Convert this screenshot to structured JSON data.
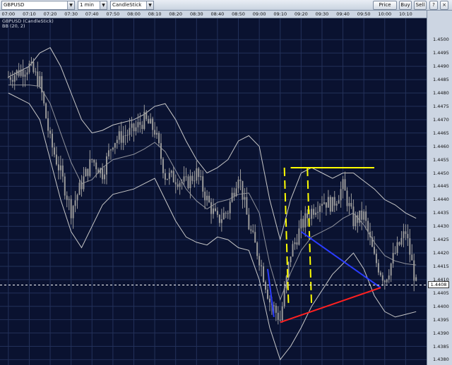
{
  "toolbar": {
    "symbol": "GBPUSD",
    "interval": "1 min",
    "chart_style": "CandleStick",
    "price_box_label": "Price Box",
    "buy_label": "Buy",
    "sell_label": "Sell",
    "icons": [
      "help-icon",
      "close-icon"
    ]
  },
  "chart_header": {
    "title": "GBPUSD (CandleStick)",
    "study": "BB (20, 2)"
  },
  "colors": {
    "background": "#0a1230",
    "grid": "#23315a",
    "candles": "#9a9a9a",
    "bands": "#c8c8c8",
    "yellow": "#ffff00",
    "blue": "#2a3cff",
    "red": "#ff2020"
  },
  "chart_data": {
    "type": "candlestick",
    "title": "GBPUSD (CandleStick)",
    "xlabel": "",
    "ylabel": "",
    "time_ticks": [
      "07:00",
      "07:10",
      "07:20",
      "07:30",
      "07:40",
      "07:50",
      "08:00",
      "08:10",
      "08:20",
      "08:30",
      "08:40",
      "08:50",
      "09:00",
      "09:10",
      "09:20",
      "09:30",
      "09:40",
      "09:50",
      "10:00",
      "10:10"
    ],
    "price_ticks": [
      "1.4500",
      "1.4495",
      "1.4490",
      "1.4485",
      "1.4480",
      "1.4475",
      "1.4470",
      "1.4465",
      "1.4460",
      "1.4455",
      "1.4450",
      "1.4445",
      "1.4440",
      "1.4435",
      "1.4430",
      "1.4425",
      "1.4420",
      "1.4415",
      "1.4410",
      "1.4405",
      "1.4400",
      "1.4395",
      "1.4390",
      "1.4385",
      "1.4380"
    ],
    "ylim": [
      1.4378,
      1.4508
    ],
    "last_price": "1.4408",
    "close_series": [
      {
        "t": "07:00",
        "v": 1.4486
      },
      {
        "t": "07:10",
        "v": 1.449
      },
      {
        "t": "07:15",
        "v": 1.4484
      },
      {
        "t": "07:20",
        "v": 1.4462
      },
      {
        "t": "07:25",
        "v": 1.445
      },
      {
        "t": "07:30",
        "v": 1.4436
      },
      {
        "t": "07:35",
        "v": 1.4446
      },
      {
        "t": "07:40",
        "v": 1.4455
      },
      {
        "t": "07:45",
        "v": 1.445
      },
      {
        "t": "07:50",
        "v": 1.4462
      },
      {
        "t": "08:00",
        "v": 1.4466
      },
      {
        "t": "08:05",
        "v": 1.447
      },
      {
        "t": "08:10",
        "v": 1.4466
      },
      {
        "t": "08:15",
        "v": 1.4449
      },
      {
        "t": "08:20",
        "v": 1.4448
      },
      {
        "t": "08:25",
        "v": 1.4446
      },
      {
        "t": "08:30",
        "v": 1.445
      },
      {
        "t": "08:35",
        "v": 1.444
      },
      {
        "t": "08:40",
        "v": 1.4432
      },
      {
        "t": "08:45",
        "v": 1.4436
      },
      {
        "t": "08:50",
        "v": 1.445
      },
      {
        "t": "08:55",
        "v": 1.443
      },
      {
        "t": "09:00",
        "v": 1.4418
      },
      {
        "t": "09:05",
        "v": 1.4402
      },
      {
        "t": "09:10",
        "v": 1.4395
      },
      {
        "t": "09:15",
        "v": 1.442
      },
      {
        "t": "09:20",
        "v": 1.443
      },
      {
        "t": "09:25",
        "v": 1.4436
      },
      {
        "t": "09:30",
        "v": 1.444
      },
      {
        "t": "09:35",
        "v": 1.4438
      },
      {
        "t": "09:40",
        "v": 1.4445
      },
      {
        "t": "09:45",
        "v": 1.4432
      },
      {
        "t": "09:50",
        "v": 1.4434
      },
      {
        "t": "09:55",
        "v": 1.4418
      },
      {
        "t": "10:00",
        "v": 1.441
      },
      {
        "t": "10:05",
        "v": 1.442
      },
      {
        "t": "10:10",
        "v": 1.4428
      },
      {
        "t": "10:15",
        "v": 1.4408
      }
    ],
    "bollinger": {
      "period": 20,
      "std": 2,
      "upper": [
        1.4486,
        1.449,
        1.4495,
        1.4497,
        1.449,
        1.448,
        1.447,
        1.4465,
        1.4466,
        1.4468,
        1.447,
        1.4472,
        1.4475,
        1.4476,
        1.447,
        1.4462,
        1.4455,
        1.445,
        1.4452,
        1.4455,
        1.4462,
        1.4464,
        1.446,
        1.444,
        1.4425,
        1.444,
        1.445,
        1.4452,
        1.445,
        1.4448,
        1.445,
        1.445,
        1.4447,
        1.4444,
        1.444,
        1.4438,
        1.4435,
        1.4433
      ],
      "lower": [
        1.448,
        1.4476,
        1.447,
        1.4455,
        1.444,
        1.4428,
        1.4422,
        1.443,
        1.4438,
        1.4442,
        1.4444,
        1.4446,
        1.4448,
        1.444,
        1.4432,
        1.4426,
        1.4424,
        1.4423,
        1.4426,
        1.4425,
        1.4422,
        1.4421,
        1.441,
        1.4392,
        1.438,
        1.4385,
        1.4392,
        1.44,
        1.4406,
        1.4412,
        1.4416,
        1.442,
        1.4414,
        1.4404,
        1.4398,
        1.4396,
        1.4397,
        1.4398
      ]
    },
    "annotations": [
      {
        "type": "horizontal",
        "color": "yellow",
        "price": 1.4452,
        "from": "09:15",
        "to": "09:55"
      },
      {
        "type": "dashed-vertical",
        "color": "yellow",
        "from_price": 1.4452,
        "to_price": 1.44
      },
      {
        "type": "trendline",
        "color": "blue",
        "from": {
          "t": "09:04",
          "v": 1.4414
        },
        "to": {
          "t": "09:07",
          "v": 1.4396
        }
      },
      {
        "type": "trendline",
        "color": "blue",
        "from": {
          "t": "09:20",
          "v": 1.4428
        },
        "to": {
          "t": "09:58",
          "v": 1.4407
        }
      },
      {
        "type": "trendline",
        "color": "red",
        "from": {
          "t": "09:10",
          "v": 1.4394
        },
        "to": {
          "t": "09:58",
          "v": 1.4407
        }
      }
    ],
    "grid": true,
    "legend": "top-left"
  }
}
